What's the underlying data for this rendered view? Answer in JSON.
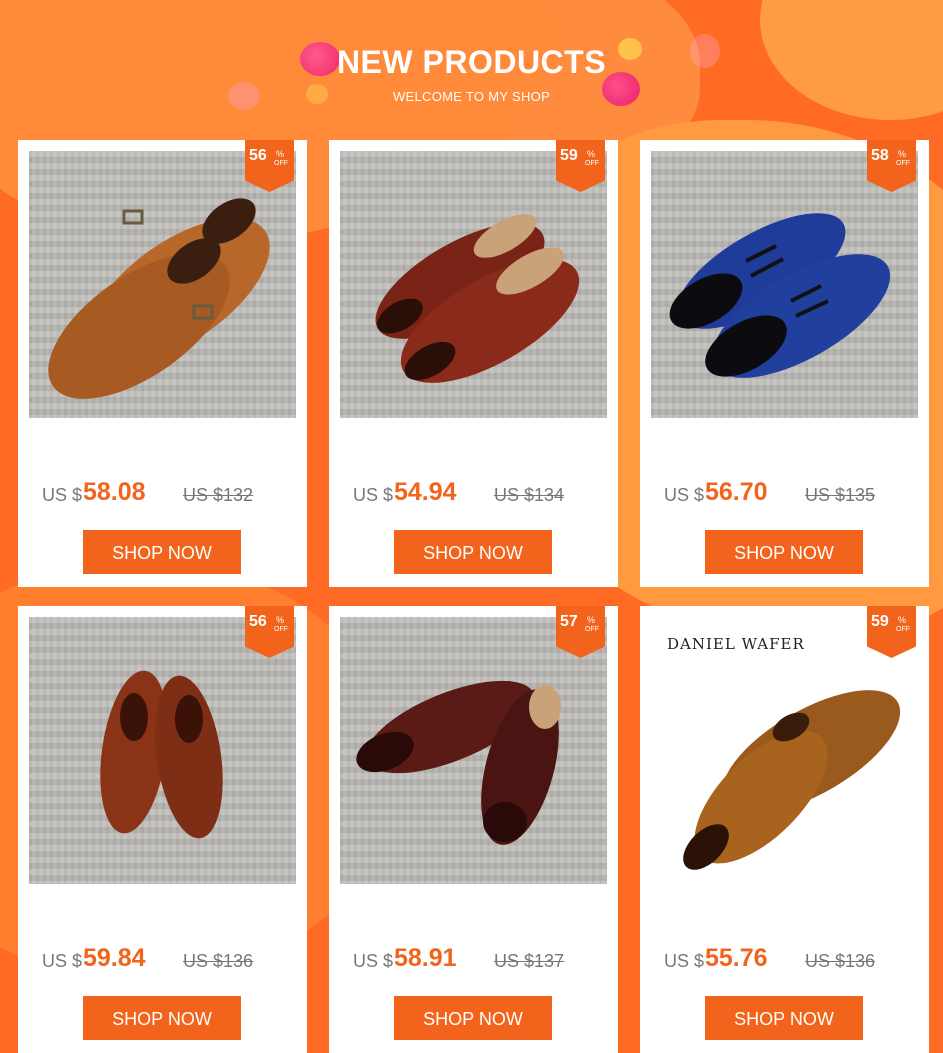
{
  "header": {
    "title": "NEW PRODUCTS",
    "subtitle": "WELCOME TO MY SHOP"
  },
  "colors": {
    "accent": "#f2641b",
    "background": "#ff6a24",
    "muted_text": "#777777"
  },
  "products": [
    {
      "discount": "56",
      "percent_symbol": "%",
      "off_label": "OFF",
      "currency": "US $",
      "price": "58.08",
      "original_price": "US $132",
      "button": "SHOP NOW",
      "brand_text": "",
      "image": "double-monk-strap-shoes-tan",
      "leather": "#b8672a"
    },
    {
      "discount": "59",
      "percent_symbol": "%",
      "off_label": "OFF",
      "currency": "US $",
      "price": "54.94",
      "original_price": "US $134",
      "button": "SHOP NOW",
      "brand_text": "",
      "image": "loafer-shoes-burgundy",
      "leather": "#7a2417"
    },
    {
      "discount": "58",
      "percent_symbol": "%",
      "off_label": "OFF",
      "currency": "US $",
      "price": "56.70",
      "original_price": "US $135",
      "button": "SHOP NOW",
      "brand_text": "",
      "image": "derby-shoes-blue-suede-patent-toe",
      "leather": "#1f3c9a"
    },
    {
      "discount": "56",
      "percent_symbol": "%",
      "off_label": "OFF",
      "currency": "US $",
      "price": "59.84",
      "original_price": "US $136",
      "button": "SHOP NOW",
      "brand_text": "",
      "image": "derby-shoes-brown",
      "leather": "#8a3316"
    },
    {
      "discount": "57",
      "percent_symbol": "%",
      "off_label": "OFF",
      "currency": "US $",
      "price": "58.91",
      "original_price": "US $137",
      "button": "SHOP NOW",
      "brand_text": "",
      "image": "cap-toe-oxford-shoes-burgundy",
      "leather": "#5a1a16"
    },
    {
      "discount": "59",
      "percent_symbol": "%",
      "off_label": "OFF",
      "currency": "US $",
      "price": "55.76",
      "original_price": "US $136",
      "button": "SHOP NOW",
      "brand_text": "DANIEL WAFER",
      "image": "derby-shoes-tan-croc",
      "leather": "#9a5a1e"
    }
  ]
}
